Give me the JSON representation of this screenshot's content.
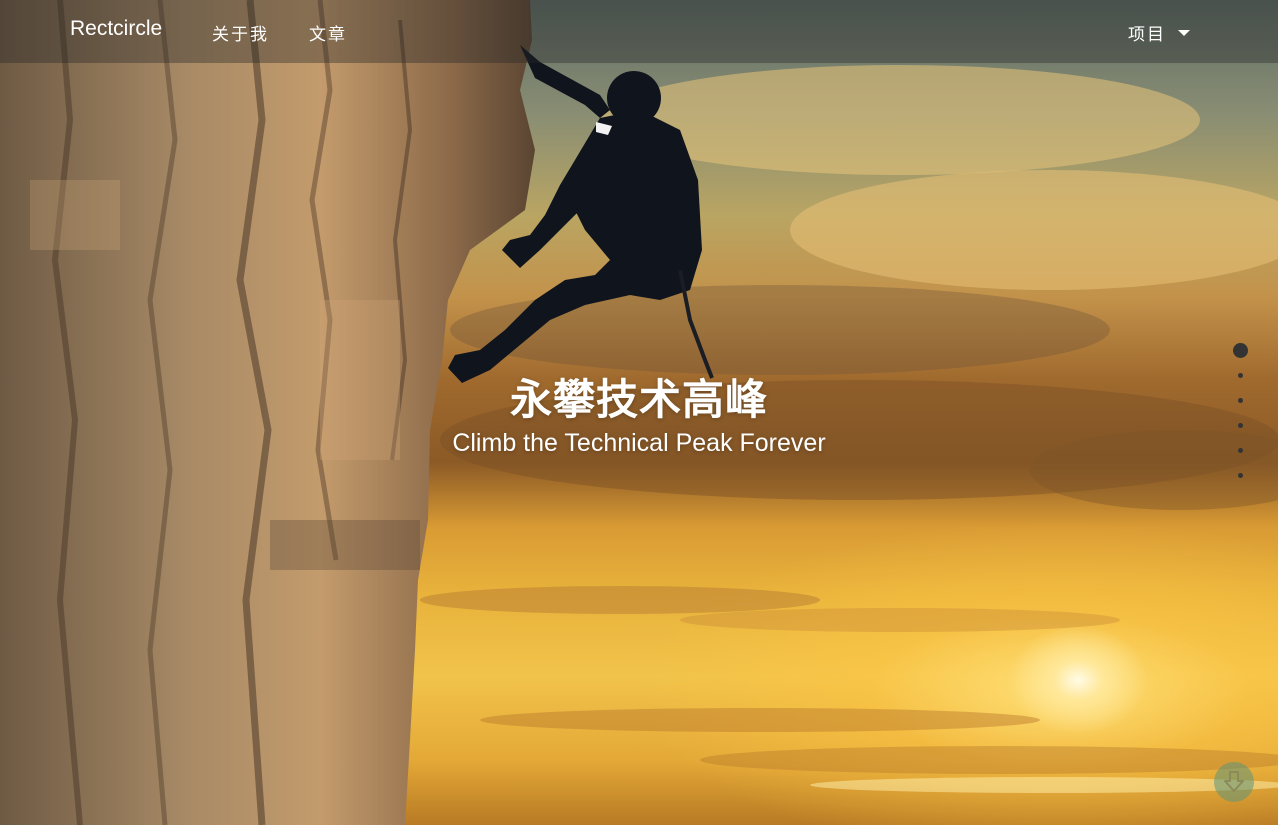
{
  "navbar": {
    "brand": "Rectcircle",
    "links": [
      "关于我",
      "文章"
    ],
    "dropdown_label": "项目"
  },
  "hero": {
    "title": "永攀技术高峰",
    "subtitle": "Climb the Technical Peak Forever"
  },
  "section_nav": {
    "count": 6,
    "active_index": 0
  },
  "icons": {
    "dropdown": "caret-down-icon",
    "scroll": "arrow-down-icon"
  },
  "colors": {
    "nav_bg": "#282828",
    "dot": "#333333",
    "scroll_button": "#5f9678",
    "text": "#ffffff"
  }
}
